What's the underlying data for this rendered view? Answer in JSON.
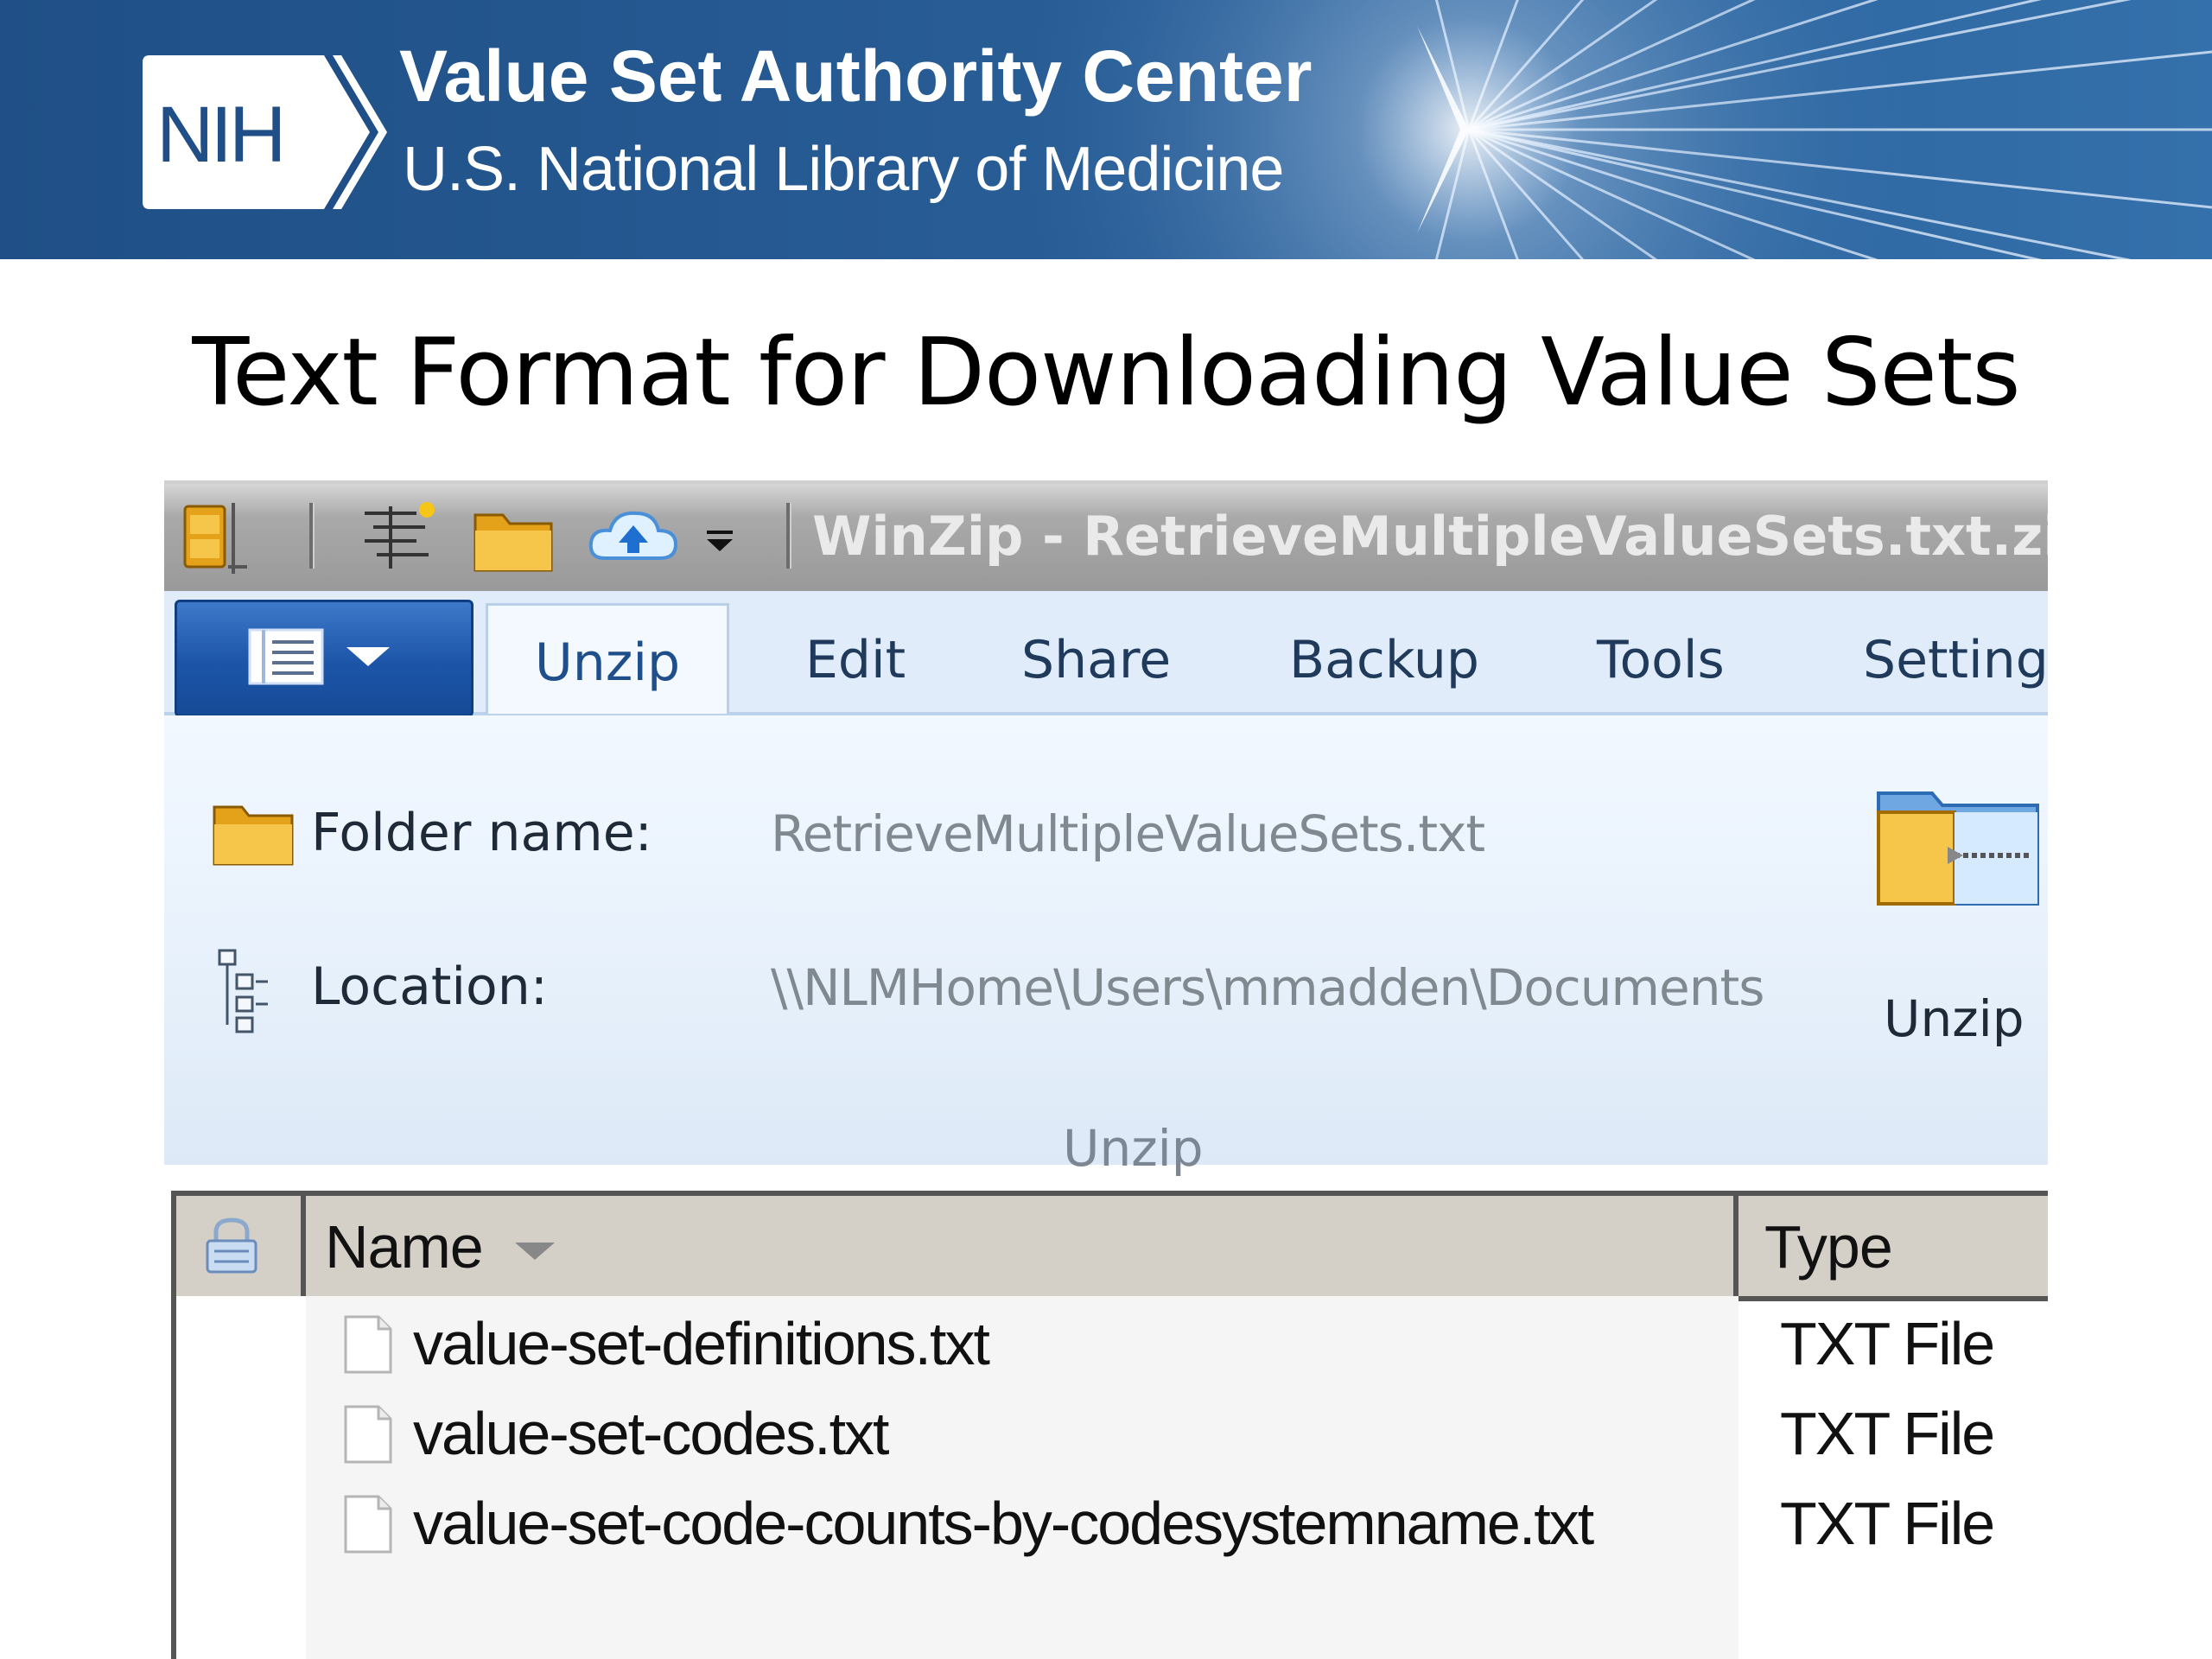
{
  "banner": {
    "logo_text": "NIH",
    "title": "Value Set Authority Center",
    "subtitle": "U.S. National Library of Medicine",
    "colors": {
      "background": "#245792",
      "text": "#ffffff"
    }
  },
  "slide": {
    "title": "Text Format for Downloading Value Sets"
  },
  "winzip": {
    "window_title": "WinZip - RetrieveMultipleValueSets.txt.zip",
    "quick_access_icons": [
      "file-cabinet-icon",
      "tree-sparkle-icon",
      "folder-icon",
      "cloud-upload-icon",
      "customize-dropdown-icon"
    ],
    "tabs": [
      {
        "label": "Unzip",
        "active": true
      },
      {
        "label": "Edit",
        "active": false
      },
      {
        "label": "Share",
        "active": false
      },
      {
        "label": "Backup",
        "active": false
      },
      {
        "label": "Tools",
        "active": false
      },
      {
        "label": "Settings",
        "active": false
      }
    ],
    "ribbon": {
      "folder_name_label": "Folder name:",
      "folder_name_value": "RetrieveMultipleValueSets.txt",
      "location_label": "Location:",
      "location_value": "\\\\NLMHome\\Users\\mmadden\\Documents",
      "unzip_button_label": "Unzip",
      "group_label": "Unzip"
    },
    "file_list": {
      "columns": {
        "name": "Name",
        "type": "Type"
      },
      "rows": [
        {
          "name": "value-set-definitions.txt",
          "type": "TXT File"
        },
        {
          "name": "value-set-codes.txt",
          "type": "TXT File"
        },
        {
          "name": "value-set-code-counts-by-codesystemname.txt",
          "type": "TXT File"
        }
      ]
    }
  }
}
